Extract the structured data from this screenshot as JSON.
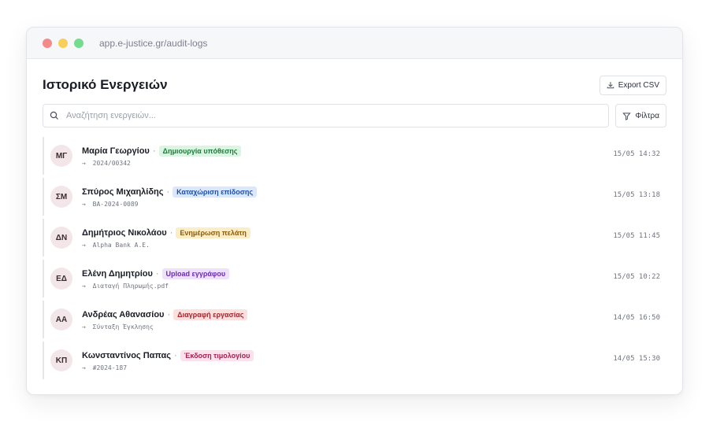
{
  "browser": {
    "url": "app.e-justice.gr/audit-logs"
  },
  "header": {
    "title": "Ιστορικό Ενεργειών",
    "export_label": "Export CSV"
  },
  "search": {
    "placeholder": "Αναζήτηση ενεργειών...",
    "filter_label": "Φίλτρα"
  },
  "entries": [
    {
      "initials": "ΜΓ",
      "user": "Μαρία Γεωργίου",
      "action": "Δημιουργία υπόθεσης",
      "action_color": "green",
      "target": "2024/00342",
      "time": "15/05 14:32"
    },
    {
      "initials": "ΣΜ",
      "user": "Σπύρος Μιχαηλίδης",
      "action": "Καταχώριση επίδοσης",
      "action_color": "blue",
      "target": "ΒΑ-2024-0089",
      "time": "15/05 13:18"
    },
    {
      "initials": "ΔΝ",
      "user": "Δημήτριος Νικολάου",
      "action": "Ενημέρωση πελάτη",
      "action_color": "yellow",
      "target": "Alpha Bank A.E.",
      "time": "15/05 11:45"
    },
    {
      "initials": "ΕΔ",
      "user": "Ελένη Δημητρίου",
      "action": "Upload εγγράφου",
      "action_color": "purple",
      "target": "Διαταγή Πληρωμής.pdf",
      "time": "15/05 10:22"
    },
    {
      "initials": "ΑΑ",
      "user": "Ανδρέας Αθανασίου",
      "action": "Διαγραφή εργασίας",
      "action_color": "red",
      "target": "Σύνταξη Έγκλησης",
      "time": "14/05 16:50"
    },
    {
      "initials": "ΚΠ",
      "user": "Κωνσταντίνος Παπας",
      "action": "Έκδοση τιμολογίου",
      "action_color": "pink",
      "target": "#2024-187",
      "time": "14/05 15:30"
    }
  ],
  "badge_colors": {
    "green": {
      "bg": "#dcf5e3",
      "fg": "#1f7a3d"
    },
    "blue": {
      "bg": "#dbe8fb",
      "fg": "#1e4fa8"
    },
    "yellow": {
      "bg": "#fbeec6",
      "fg": "#8a5a0c"
    },
    "purple": {
      "bg": "#eee2fb",
      "fg": "#6a2bb0"
    },
    "red": {
      "bg": "#fbe0e0",
      "fg": "#a8242a"
    },
    "pink": {
      "bg": "#fbe2ec",
      "fg": "#a1234f"
    }
  },
  "row_separator": "·",
  "target_arrow": "→"
}
